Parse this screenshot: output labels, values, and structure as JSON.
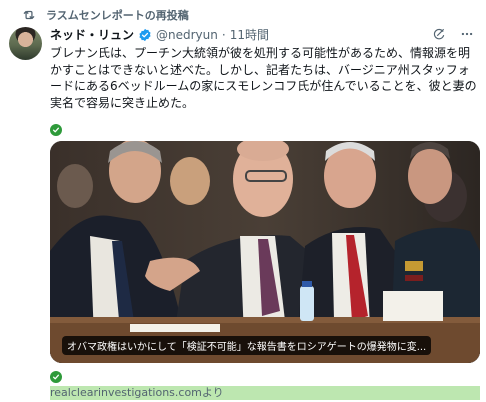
{
  "retweet": {
    "label": "ラスムセンレポートの再投稿"
  },
  "author": {
    "name": "ネッド・リュン",
    "handle": "@nedryun",
    "separator": "·",
    "time": "11時間"
  },
  "tweet": {
    "text": "ブレナン氏は、プーチン大統領が彼を処刑する可能性があるため、情報源を明かすことはできないと述べた。しかし、記者たちは、バージニア州スタッフォードにある6ベッドルームの家にスモレンコフ氏が住んでいることを、彼と妻の実名で容易に突き止めた。"
  },
  "card": {
    "caption": "オバマ政権はいかにして「検証不可能」な報告書をロシアゲートの爆発物に変..."
  },
  "source": {
    "text": "realclearinvestigations.comより"
  },
  "colors": {
    "check": "#2e9a3a",
    "verified": "#1d9bf0",
    "source_bg": "#bde7b0"
  },
  "icons": [
    "retweet-icon",
    "verified-badge-icon",
    "grok-icon",
    "more-icon",
    "check-icon"
  ]
}
